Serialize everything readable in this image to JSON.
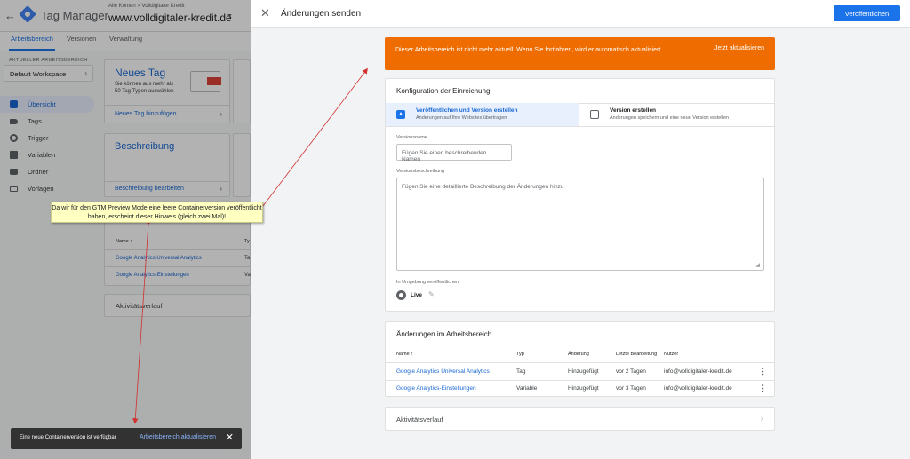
{
  "background_app": {
    "app_title": "Tag Manager",
    "breadcrumb": "Alle Konten > Volldigitaler Kredit",
    "account_name": "www.volldigitaler-kredit.de",
    "tabs": [
      "Arbeitsbereich",
      "Versionen",
      "Verwaltung"
    ],
    "workspace_label": "AKTUELLER ARBEITSBEREICH",
    "workspace_name": "Default Workspace",
    "nav": [
      "Übersicht",
      "Tags",
      "Trigger",
      "Variablen",
      "Ordner",
      "Vorlagen"
    ],
    "new_tag": {
      "title": "Neues Tag",
      "description": "Sie können aus mehr als 50 Tag-Typen auswählen",
      "link": "Neues Tag hinzufügen"
    },
    "description_card": {
      "title": "Beschreibung",
      "link": "Beschreibung bearbeiten"
    },
    "changes_table": {
      "col_name": "Name ↑",
      "col_type": "Ty",
      "rows": [
        {
          "name": "Google Analytics Universal Analytics",
          "type": "Ta"
        },
        {
          "name": "Google Analytics-Einstellungen",
          "type": "Va"
        }
      ]
    },
    "activity": "Aktivitätsverlauf",
    "snackbar": {
      "message": "Eine neue Containerversion ist verfügbar",
      "action": "Arbeitsbereich aktualisieren"
    }
  },
  "panel": {
    "title": "Änderungen senden",
    "publish_button": "Veröffentlichen",
    "warning": {
      "text": "Dieser Arbeitsbereich ist nicht mehr aktuell. Wenn Sie fortfahren, wird er automatisch aktualisiert.",
      "action": "Jetzt aktualisieren"
    },
    "config": {
      "title": "Konfiguration der Einreichung",
      "option1_title": "Veröffentlichen und Version erstellen",
      "option1_sub": "Änderungen auf Ihre Websites übertragen",
      "option2_title": "Version erstellen",
      "option2_sub": "Änderungen speichern und eine neue Version erstellen",
      "version_name_label": "Versionsname",
      "version_name_placeholder": "Fügen Sie einen beschreibenden Namen",
      "version_desc_label": "Versionsbeschreibung",
      "version_desc_placeholder": "Fügen Sie eine detaillierte Beschreibung der Änderungen hinzu",
      "env_label": "In Umgebung veröffentlichen",
      "env_name": "Live"
    },
    "changes": {
      "title": "Änderungen im Arbeitsbereich",
      "columns": {
        "name": "Name ↑",
        "type": "Typ",
        "change": "Änderung",
        "last_edit": "Letzte Bearbeitung",
        "user": "Nutzer"
      },
      "rows": [
        {
          "name": "Google Analytics Universal Analytics",
          "type": "Tag",
          "change": "Hinzugefügt",
          "last_edit": "vor 2 Tagen",
          "user": "info@volldigitaler-kredit.de"
        },
        {
          "name": "Google Analytics-Einstellungen",
          "type": "Variable",
          "change": "Hinzugefügt",
          "last_edit": "vor 3 Tagen",
          "user": "info@volldigitaler-kredit.de"
        }
      ]
    },
    "activity": "Aktivitätsverlauf"
  },
  "annotation": {
    "text": "Da wir für den GTM Preview Mode eine leere Containerversion veröffentlicht haben, erscheint dieser Hinweis (gleich zwei Mal)!",
    "color": "#ffffc2",
    "arrow_color": "#d32f2f"
  },
  "colors": {
    "accent": "#1a73e8",
    "warning": "#ef6c00",
    "snackbar": "#323232"
  }
}
